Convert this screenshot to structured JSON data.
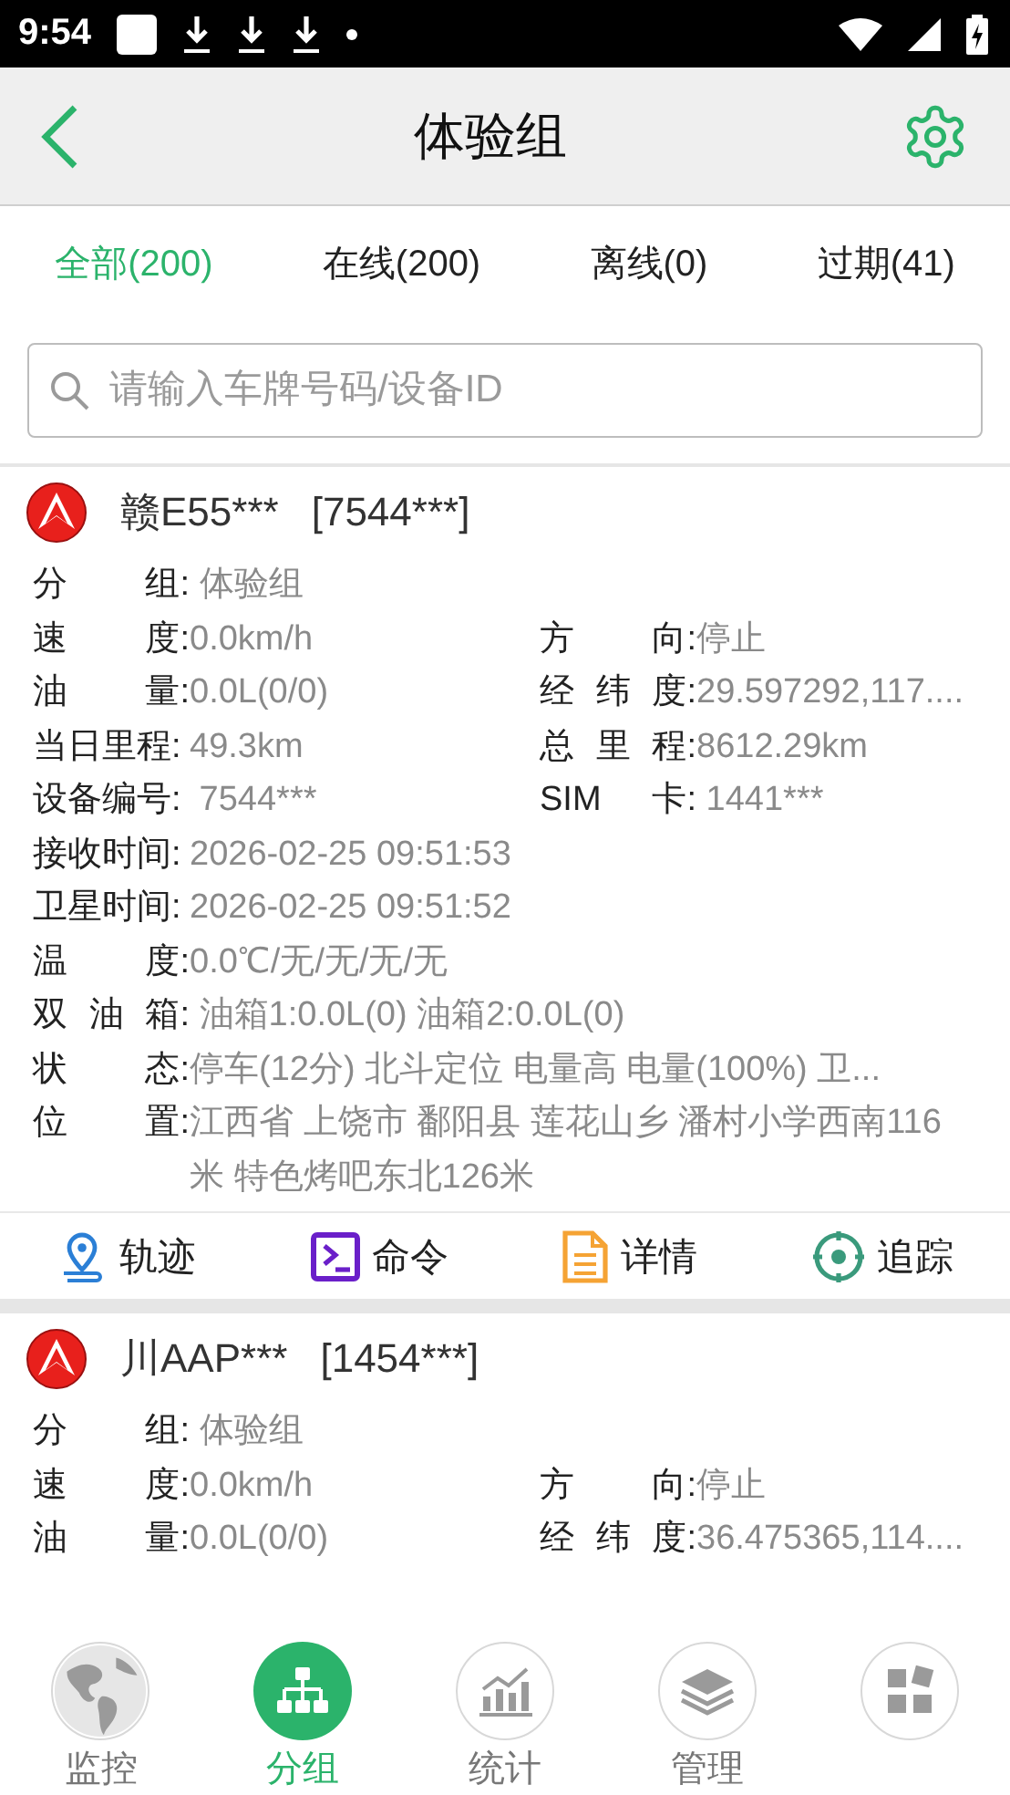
{
  "status_bar": {
    "time": "9:54"
  },
  "header": {
    "title": "体验组"
  },
  "tabs": [
    {
      "label": "全部(200)",
      "selected": true
    },
    {
      "label": "在线(200)",
      "selected": false
    },
    {
      "label": "离线(0)",
      "selected": false
    },
    {
      "label": "过期(41)",
      "selected": false
    }
  ],
  "search": {
    "placeholder": "请输入车牌号码/设备ID"
  },
  "vehicles": [
    {
      "plate": "赣E55***",
      "device": "[7544***]",
      "rows": [
        [
          {
            "label": "分 组:",
            "value": " 体验组"
          }
        ],
        [
          {
            "label": "速 度:",
            "value": "0.0km/h"
          },
          {
            "label": "方 向:",
            "value": "停止"
          }
        ],
        [
          {
            "label": "油 量:",
            "value": "0.0L(0/0)"
          },
          {
            "label": "经 纬 度:",
            "value": "29.597292,117...."
          }
        ],
        [
          {
            "label": "当日里程:",
            "value": "49.3km"
          },
          {
            "label": "总 里 程:",
            "value": "8612.29km"
          }
        ],
        [
          {
            "label": "设备编号:",
            "value": " 7544***"
          },
          {
            "label": "SIM 卡:",
            "value": " 1441***"
          }
        ],
        [
          {
            "label": "接收时间:",
            "value": "2026-02-25 09:51:53"
          }
        ],
        [
          {
            "label": "卫星时间:",
            "value": "2026-02-25 09:51:52"
          }
        ],
        [
          {
            "label": "温 度:",
            "value": "0.0℃/无/无/无/无"
          }
        ],
        [
          {
            "label": "双 油 箱:",
            "value": " 油箱1:0.0L(0) 油箱2:0.0L(0)"
          }
        ],
        [
          {
            "label": "状 态:",
            "value": "停车(12分) 北斗定位 电量高 电量(100%) 卫..."
          }
        ],
        [
          {
            "label": "位 置:",
            "value": "江西省 上饶市 鄱阳县 莲花山乡 潘村小学西南116米 特色烤吧东北126米"
          }
        ]
      ],
      "actions": [
        {
          "label": "轨迹",
          "kind": "track"
        },
        {
          "label": "命令",
          "kind": "command"
        },
        {
          "label": "详情",
          "kind": "details"
        },
        {
          "label": "追踪",
          "kind": "follow"
        }
      ]
    },
    {
      "plate": "川AAP***",
      "device": "[1454***]",
      "rows": [
        [
          {
            "label": "分 组:",
            "value": " 体验组"
          }
        ],
        [
          {
            "label": "速 度:",
            "value": "0.0km/h"
          },
          {
            "label": "方 向:",
            "value": "停止"
          }
        ],
        [
          {
            "label": "油 量:",
            "value": "0.0L(0/0)"
          },
          {
            "label": "经 纬 度:",
            "value": "36.475365,114...."
          }
        ]
      ]
    }
  ],
  "bottom_nav": [
    {
      "label": "监控",
      "kind": "globe",
      "selected": false
    },
    {
      "label": "分组",
      "kind": "org",
      "selected": true
    },
    {
      "label": "统计",
      "kind": "chart",
      "selected": false
    },
    {
      "label": "管理",
      "kind": "layers",
      "selected": false
    },
    {
      "kind": "apps",
      "selected": false
    }
  ]
}
